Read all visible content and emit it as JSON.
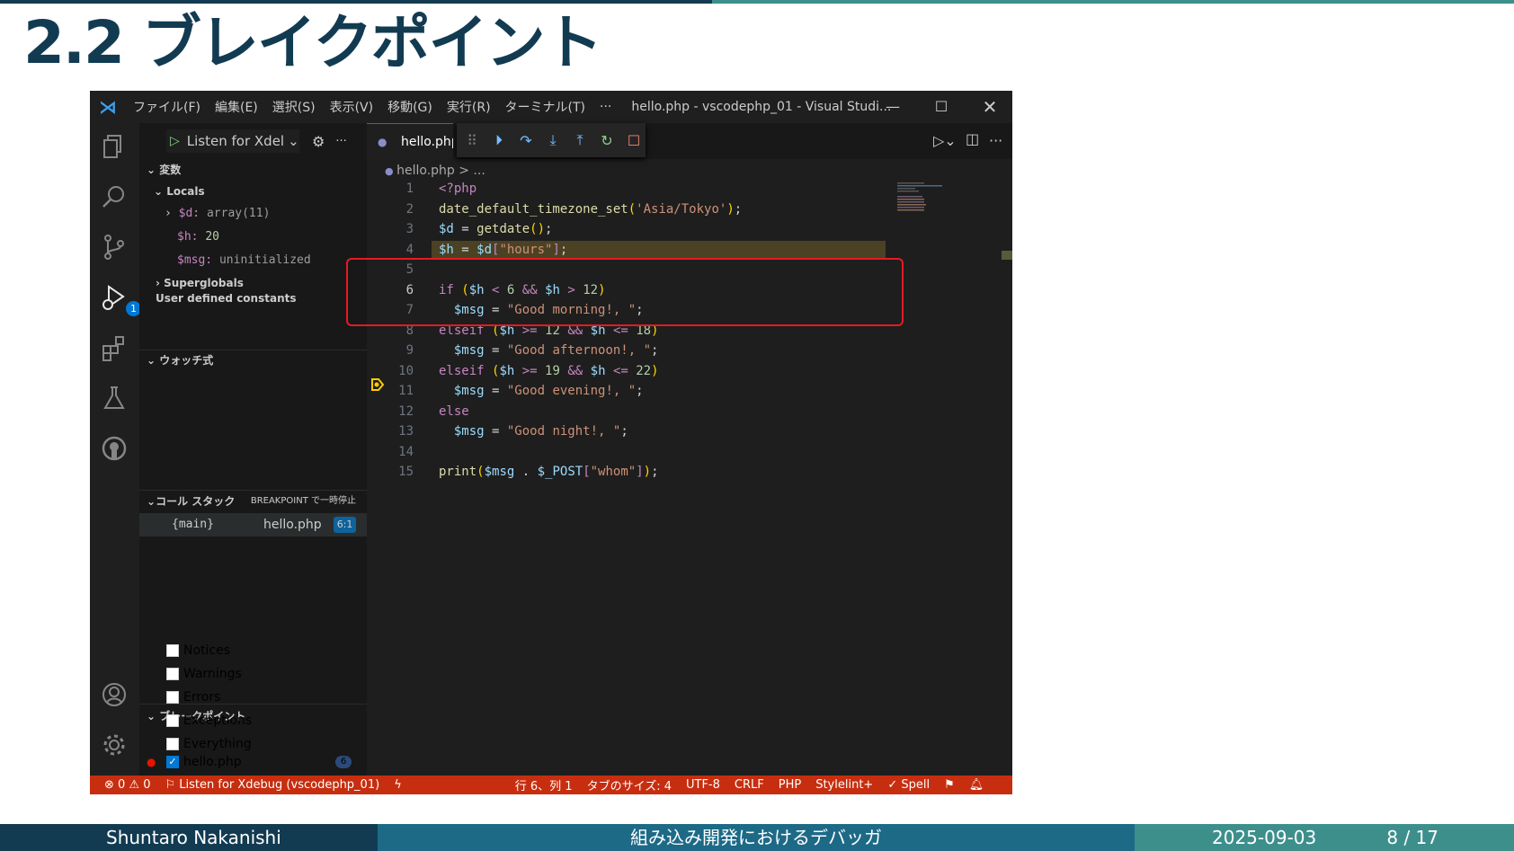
{
  "slide": {
    "title": "2.2 ブレイクポイント",
    "footer_author": "Shuntaro Nakanishi",
    "footer_title": "組み込み開発におけるデバッガ",
    "footer_date": "2025-09-03",
    "footer_page": "8 / 17"
  },
  "window": {
    "menu": [
      "ファイル(F)",
      "編集(E)",
      "選択(S)",
      "表示(V)",
      "移動(G)",
      "実行(R)",
      "ターミナル(T)",
      "···"
    ],
    "title": "hello.php - vscodephp_01 - Visual Studi..."
  },
  "sidebar": {
    "launch_config": "Listen for Xdel",
    "variables_header": "変数",
    "locals_header": "Locals",
    "locals": [
      {
        "name": "$d:",
        "value": "array(11)"
      },
      {
        "name": "$h:",
        "value": "20"
      },
      {
        "name": "$msg:",
        "value": "uninitialized"
      }
    ],
    "superglobals": "Superglobals",
    "user_constants": "User defined constants",
    "watch_header": "ウォッチ式",
    "callstack_header": "コール スタック",
    "callstack_status": "BREAKPOINT で一時停止",
    "callstack_frame": {
      "name": "{main}",
      "file": "hello.php",
      "pos": "6:1"
    },
    "breakpoints_header": "ブレークポイント",
    "breakpoints": [
      "Notices",
      "Warnings",
      "Errors",
      "Exceptions",
      "Everything"
    ],
    "breakpoint_file": "hello.php",
    "breakpoint_file_line": "6",
    "debug_badge": "1"
  },
  "editor": {
    "tab": "hello.php",
    "breadcrumb": "hello.php > ...",
    "current_line": 6
  },
  "statusbar": {
    "problems": "⊗ 0 ⚠ 0",
    "debug": "Listen for Xdebug (vscodephp_01)",
    "position": "行 6、列 1",
    "tab_size": "タブのサイズ: 4",
    "encoding": "UTF-8",
    "eol": "CRLF",
    "language": "PHP",
    "linter": "Stylelint+",
    "spell": "✓ Spell"
  },
  "colors": {
    "slide_title": "#123b52",
    "statusbar": "#c72e0f",
    "highlight_box": "#e31b23"
  }
}
